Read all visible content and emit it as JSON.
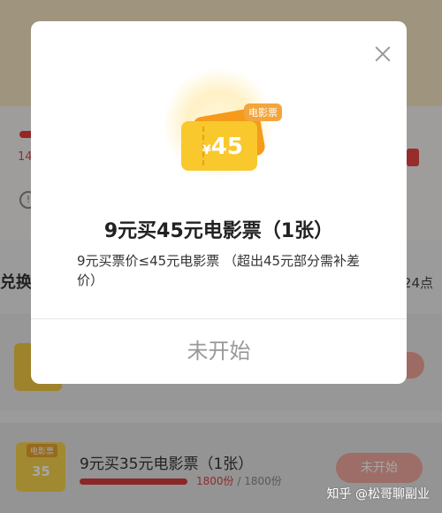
{
  "background": {
    "left_text": "14",
    "section_left": "兑换",
    "section_right": "24点",
    "row2": {
      "title": "9元买35元电影票（1张）",
      "thumb_tag": "电影票",
      "thumb_price": "35",
      "count_a": "1800份",
      "count_sep": "/",
      "count_b": "1800份",
      "button": "未开始"
    }
  },
  "modal": {
    "ticket_tag": "电影票",
    "ticket_currency": "¥",
    "ticket_price": "45",
    "title": "9元买45元电影票（1张）",
    "desc": "9元买票价≤45元电影票 （超出45元部分需补差价）",
    "action": "未开始"
  },
  "watermark": "知乎 @松哥聊副业",
  "colors": {
    "overlay": "#000000",
    "accent_red": "#d43d3d",
    "ticket_yellow": "#f8c82d",
    "ticket_orange": "#f59a1a"
  }
}
